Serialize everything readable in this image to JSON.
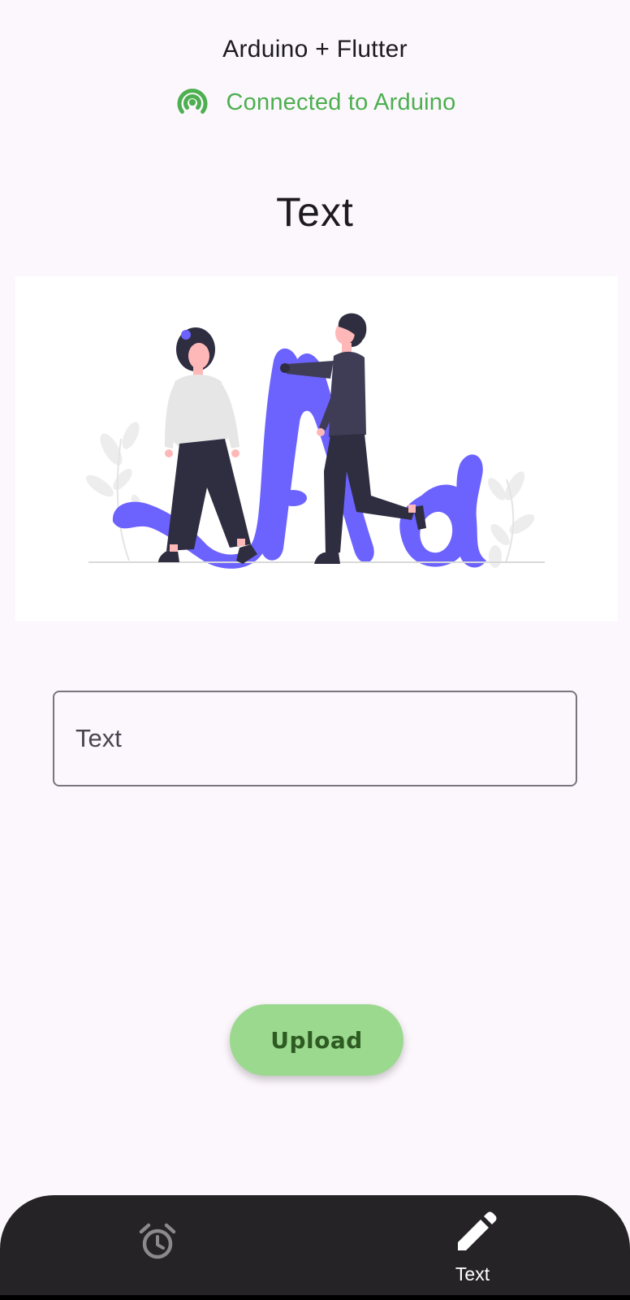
{
  "app": {
    "title": "Arduino + Flutter"
  },
  "status": {
    "text": "Connected to Arduino",
    "icon": "signal-broadcast-icon",
    "color": "#4caf50"
  },
  "page": {
    "title": "Text"
  },
  "text_field": {
    "placeholder": "Text",
    "value": ""
  },
  "upload_button": {
    "label": "Upload",
    "color": "#9bd98f"
  },
  "bottom_nav": {
    "items": [
      {
        "icon": "alarm-icon",
        "label": "",
        "selected": false
      },
      {
        "icon": "pencil-icon",
        "label": "Text",
        "selected": true
      }
    ]
  },
  "colors": {
    "background": "#fcf7fc",
    "accent": "#6c63ff",
    "nav_background": "#252326"
  }
}
